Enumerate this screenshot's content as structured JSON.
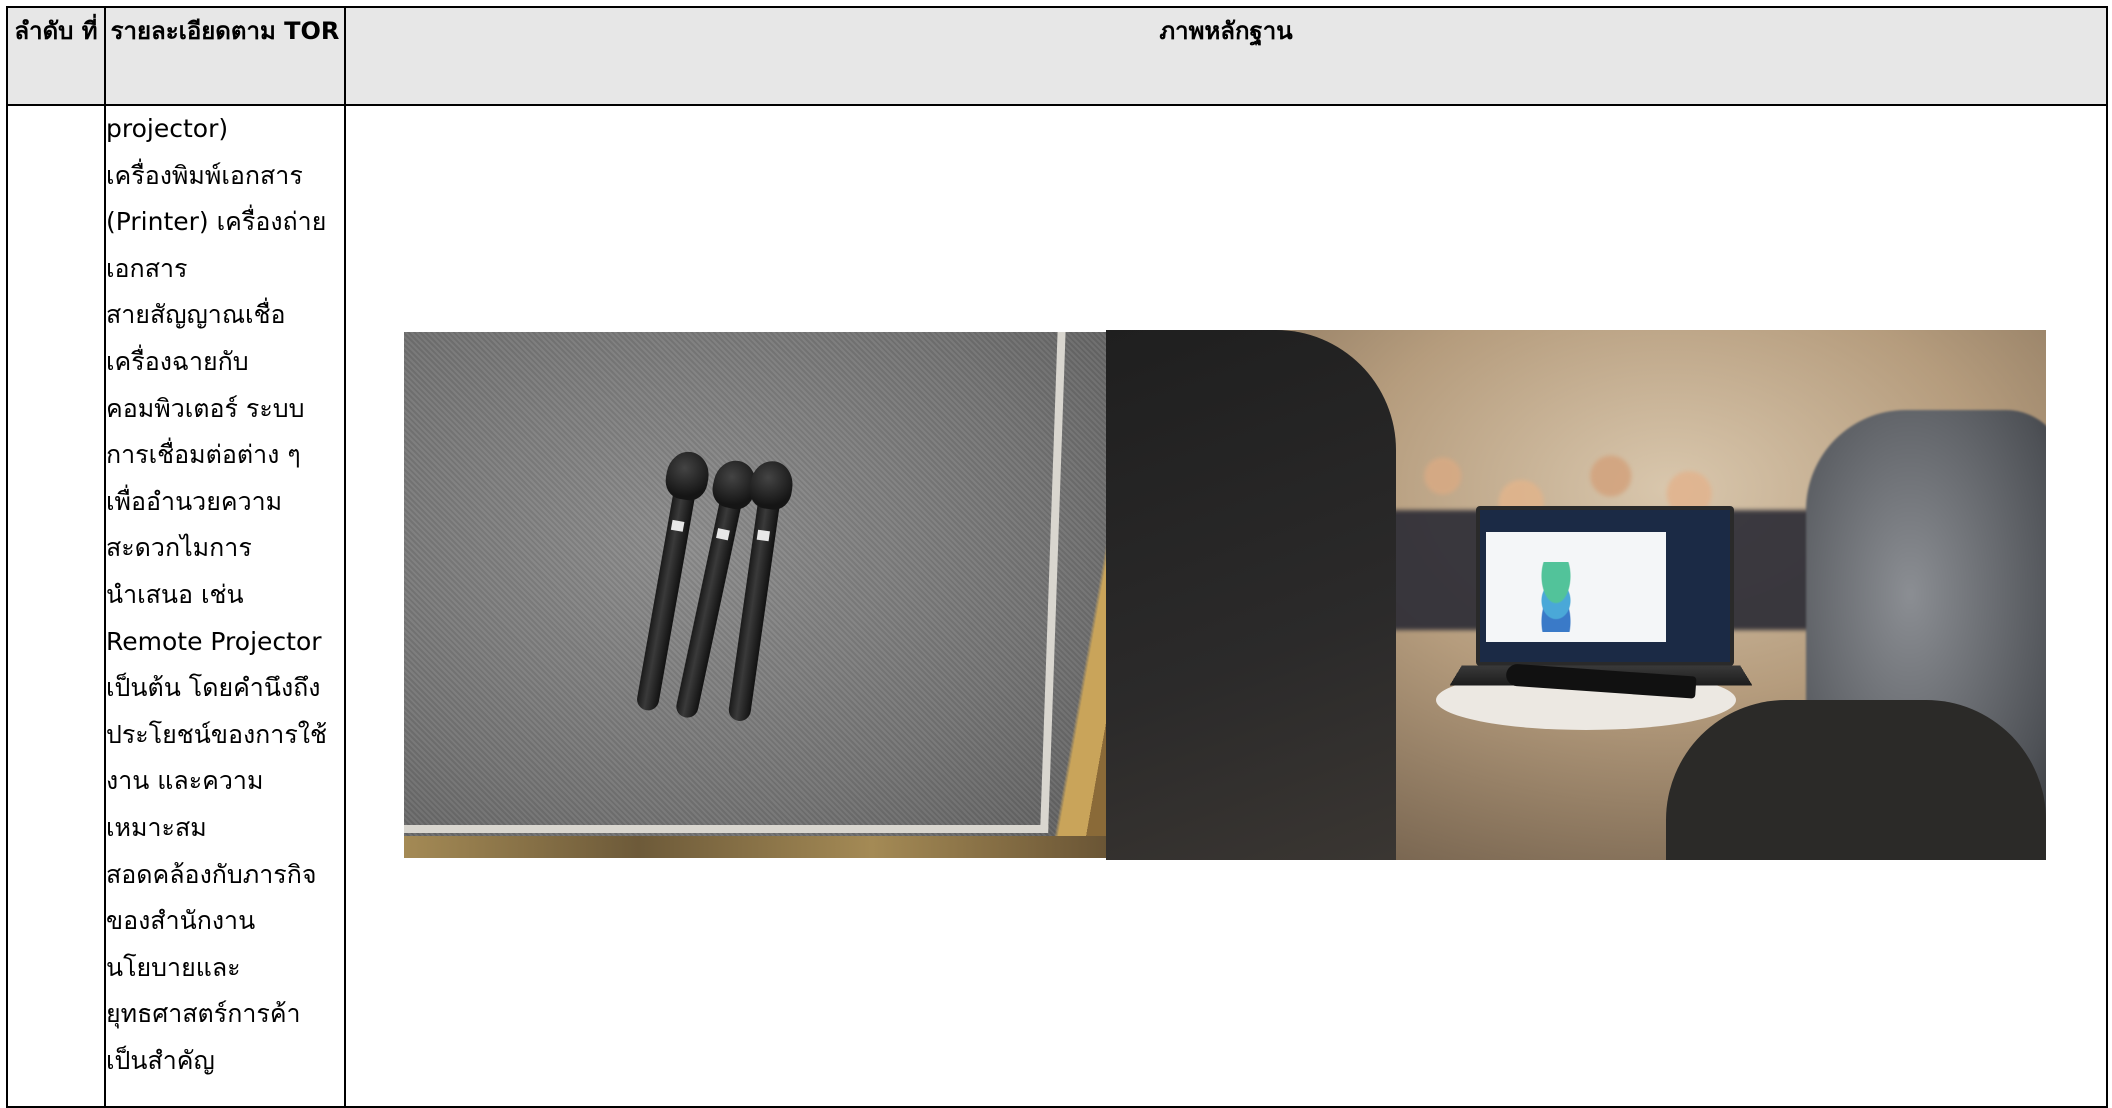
{
  "table": {
    "headers": {
      "no": "ลำดับ ที่",
      "detail": "รายละเอียดตาม TOR",
      "evidence": "ภาพหลักฐาน"
    },
    "row": {
      "no": "",
      "detail_lines": [
        "projector)",
        "เครื่องพิมพ์เอกสาร",
        "(Printer) เครื่องถ่าย",
        "เอกสาร",
        "สายสัญญาณเชื่อ",
        "เครื่องฉายกับ",
        "คอมพิวเตอร์ ระบบ",
        "การเชื่อมต่อต่าง ๆ",
        "เพื่ออำนวยความ",
        "สะดวกไมการ",
        "นำเสนอ เช่น",
        "Remote Projector",
        "เป็นต้น โดยคำนึงถึง",
        "ประโยชน์ของการใช้",
        "งาน และความ",
        "เหมาะสม",
        "สอดคล้องกับภารกิจ",
        "ของสำนักงาน",
        "นโยบายและ",
        "ยุทธศาสตร์การค้า",
        "เป็นสำคัญ"
      ]
    }
  }
}
